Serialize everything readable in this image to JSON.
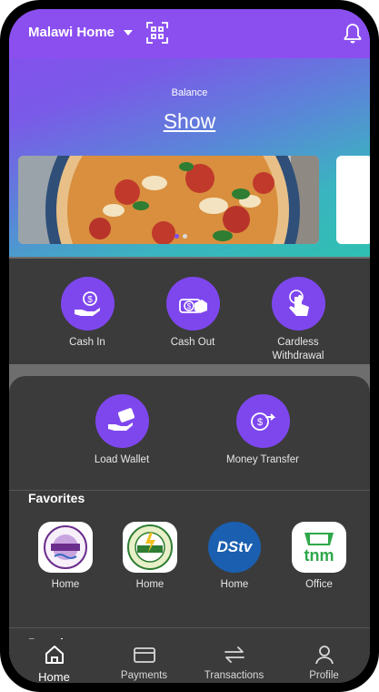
{
  "header": {
    "location": "Malawi Home"
  },
  "balance": {
    "label": "Balance",
    "show": "Show"
  },
  "quick_actions": [
    {
      "label": "Cash In",
      "icon": "hand-dollar-icon"
    },
    {
      "label": "Cash Out",
      "icon": "cash-out-icon"
    },
    {
      "label": "Cardless Withdrawal",
      "icon": "touch-icon"
    }
  ],
  "wallet_actions": [
    {
      "label": "Load Wallet",
      "icon": "wallet-hand-icon"
    },
    {
      "label": "Money Transfer",
      "icon": "transfer-icon"
    }
  ],
  "favorites": {
    "title": "Favorites",
    "items": [
      {
        "label": "Home",
        "logo_text": "MALAWI",
        "logo_caption": "SOUTHERN REGION WATER BOARD"
      },
      {
        "label": "Home",
        "logo_text": "ESCOM",
        "logo_caption": "ELECTRICITY SUPPLY CORPORATION OF MALAWI LTD"
      },
      {
        "label": "Home",
        "logo_text": "DStv"
      },
      {
        "label": "Office",
        "logo_text": "tnm"
      }
    ]
  },
  "popular": {
    "title": "Popular"
  },
  "tabs": [
    {
      "label": "Home",
      "icon": "home-icon",
      "active": true
    },
    {
      "label": "Payments",
      "icon": "card-icon"
    },
    {
      "label": "Transactions",
      "icon": "arrows-icon"
    },
    {
      "label": "Profile",
      "icon": "profile-icon"
    }
  ],
  "colors": {
    "accent": "#7e47ee",
    "panel": "#3b3b3b"
  }
}
